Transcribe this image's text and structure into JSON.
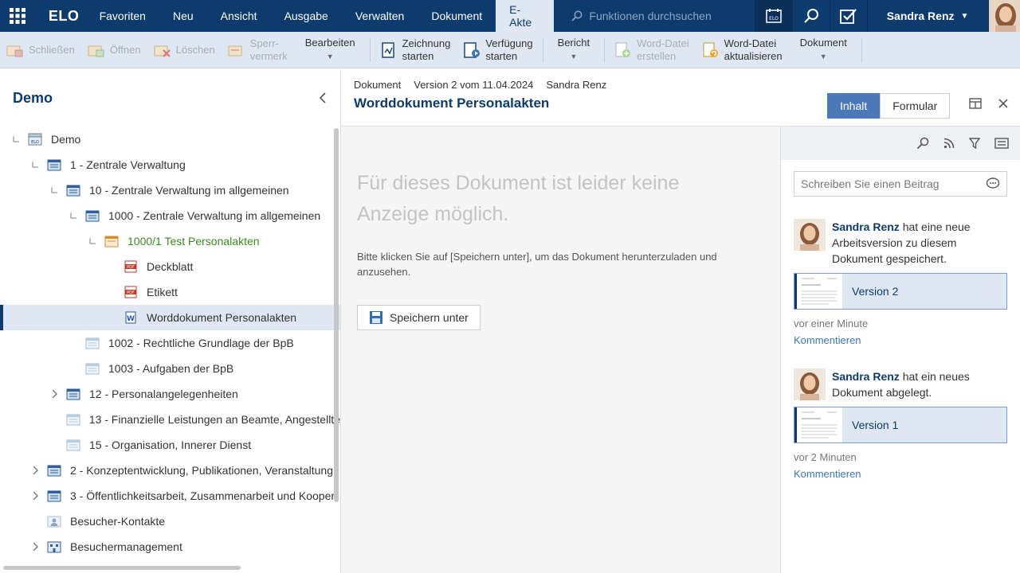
{
  "topbar": {
    "logo": "ELO",
    "nav": [
      "Favoriten",
      "Neu",
      "Ansicht",
      "Ausgabe",
      "Verwalten",
      "Dokument",
      "E-Akte"
    ],
    "active_nav": "E-Akte",
    "search_placeholder": "Funktionen durchsuchen",
    "user_name": "Sandra Renz"
  },
  "toolbar": {
    "close": "Schließen",
    "open": "Öffnen",
    "delete": "Löschen",
    "lock_line1": "Sperr-",
    "lock_line2": "vermerk",
    "edit": "Bearbeiten",
    "sign_line1": "Zeichnung",
    "sign_line2": "starten",
    "order_line1": "Verfügung",
    "order_line2": "starten",
    "report": "Bericht",
    "word_create_line1": "Word-Datei",
    "word_create_line2": "erstellen",
    "word_update_line1": "Word-Datei",
    "word_update_line2": "aktualisieren",
    "document": "Dokument"
  },
  "left": {
    "title": "Demo",
    "tree": [
      {
        "label": "Demo",
        "level": 0,
        "exp": "line",
        "icon": "archive",
        "state": ""
      },
      {
        "label": "1 - Zentrale Verwaltung",
        "level": 1,
        "exp": "line",
        "icon": "folder-blue",
        "state": ""
      },
      {
        "label": "10 - Zentrale Verwaltung im allgemeinen",
        "level": 2,
        "exp": "line",
        "icon": "folder-blue",
        "state": ""
      },
      {
        "label": "1000 - Zentrale Verwaltung im allgemeinen",
        "level": 3,
        "exp": "line",
        "icon": "folder-blue",
        "state": ""
      },
      {
        "label": "1000/1 Test Personalakten",
        "level": 4,
        "exp": "line",
        "icon": "folder-orange",
        "state": "green"
      },
      {
        "label": "Deckblatt",
        "level": 5,
        "exp": "",
        "icon": "pdf",
        "state": ""
      },
      {
        "label": "Etikett",
        "level": 5,
        "exp": "",
        "icon": "pdf",
        "state": ""
      },
      {
        "label": "Worddokument Personalakten",
        "level": 5,
        "exp": "",
        "icon": "word",
        "state": "selected"
      },
      {
        "label": "1002 - Rechtliche Grundlage der BpB",
        "level": 3,
        "exp": "",
        "icon": "folder-light",
        "state": ""
      },
      {
        "label": "1003 - Aufgaben der BpB",
        "level": 3,
        "exp": "",
        "icon": "folder-light",
        "state": ""
      },
      {
        "label": "12 - Personalangelegenheiten",
        "level": 2,
        "exp": "chevron",
        "icon": "folder-blue",
        "state": ""
      },
      {
        "label": "13 - Finanzielle Leistungen an Beamte, Angestellte",
        "level": 2,
        "exp": "",
        "icon": "folder-light",
        "state": ""
      },
      {
        "label": "15 - Organisation, Innerer Dienst",
        "level": 2,
        "exp": "",
        "icon": "folder-light",
        "state": ""
      },
      {
        "label": "2 - Konzeptentwicklung, Publikationen, Veranstaltung",
        "level": 1,
        "exp": "chevron",
        "icon": "folder-blue",
        "state": ""
      },
      {
        "label": "3 - Öffentlichkeitsarbeit, Zusammenarbeit und Kooper",
        "level": 1,
        "exp": "chevron",
        "icon": "folder-blue",
        "state": ""
      },
      {
        "label": "Besucher-Kontakte",
        "level": 1,
        "exp": "",
        "icon": "contacts",
        "state": ""
      },
      {
        "label": "Besuchermanagement",
        "level": 1,
        "exp": "chevron",
        "icon": "building",
        "state": ""
      }
    ]
  },
  "content": {
    "meta_type": "Dokument",
    "meta_version": "Version 2 vom 11.04.2024",
    "meta_user": "Sandra Renz",
    "title": "Worddokument Personalakten",
    "tab_content": "Inhalt",
    "tab_form": "Formular",
    "preview_heading": "Für dieses Dokument ist leider keine Anzeige möglich.",
    "preview_text": "Bitte klicken Sie auf [Speichern unter], um das Dokument herunterzuladen und anzusehen.",
    "save_button": "Speichern unter"
  },
  "feed": {
    "input_placeholder": "Schreiben Sie einen Beitrag",
    "posts": [
      {
        "who": "Sandra Renz",
        "text": " hat eine neue Arbeitsversion zu diesem Dokument gespeichert.",
        "version": "Version 2",
        "time": "vor einer Minute",
        "link": "Kommentieren"
      },
      {
        "who": "Sandra Renz",
        "text": " hat ein neues Dokument abgelegt.",
        "version": "Version 1",
        "time": "vor 2 Minuten",
        "link": "Kommentieren"
      }
    ]
  },
  "colors": {
    "nav_bg": "#0d3b6e",
    "toolbar_bg": "#dfe8f2",
    "accent": "#4a78b8",
    "selected_text": "#3b8a1f"
  }
}
